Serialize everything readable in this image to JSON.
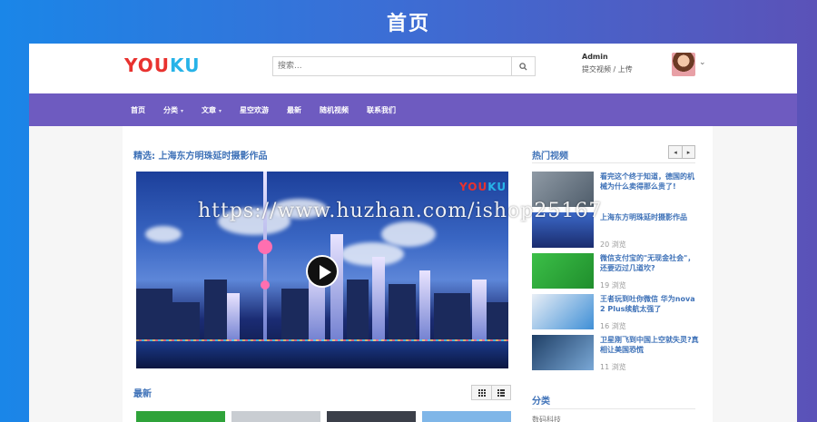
{
  "page_heading": "首页",
  "header": {
    "logo": [
      "Y",
      "O",
      "U",
      "K",
      "U"
    ],
    "search_placeholder": "搜索...",
    "user_name": "Admin",
    "user_links": "提交视频 / 上传"
  },
  "nav": {
    "items": [
      {
        "label": "首页",
        "dropdown": false
      },
      {
        "label": "分类",
        "dropdown": true
      },
      {
        "label": "文章",
        "dropdown": true
      },
      {
        "label": "星空欢游",
        "dropdown": false
      },
      {
        "label": "最新",
        "dropdown": false
      },
      {
        "label": "随机视频",
        "dropdown": false
      },
      {
        "label": "联系我们",
        "dropdown": false
      }
    ]
  },
  "featured": {
    "title": "精选: 上海东方明珠延时摄影作品",
    "video_logo": "YOUKU"
  },
  "latest": {
    "title": "最新"
  },
  "sidebar": {
    "hot_title": "热门视频",
    "pager_prev": "◂",
    "pager_next": "▸",
    "items": [
      {
        "title": "看完这个终于知道，德国的机械为什么卖得那么贵了!",
        "views": "",
        "color": "#7f8d9b"
      },
      {
        "title": "上海东方明珠延时摄影作品",
        "views": "20 浏览",
        "color": "#2a4aa8"
      },
      {
        "title": "微信支付宝的\"无现金社会\"，还要迈过几道坎?",
        "views": "19 浏览",
        "color": "#2fae3c"
      },
      {
        "title": "王者玩到吐你微信 华为nova 2 Plus续航太强了",
        "views": "16 浏览",
        "color": "#3f8fd6"
      },
      {
        "title": "卫星刚飞到中国上空就失灵?真相让美国恐慌",
        "views": "11 浏览",
        "color": "#315f8f"
      }
    ],
    "cat_title": "分类",
    "cat_first": "数码科技"
  },
  "watermark": "https://www.huzhan.com/ishop25167"
}
